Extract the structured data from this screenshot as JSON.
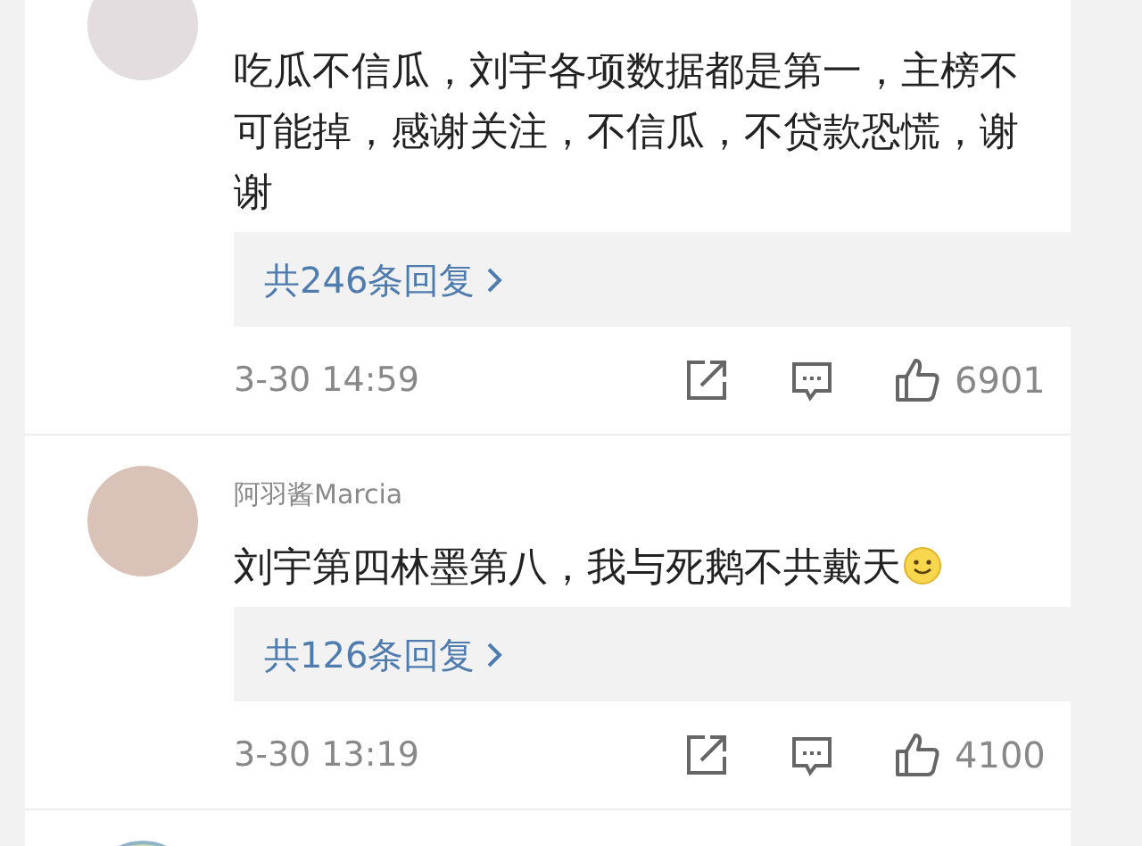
{
  "comments": [
    {
      "text": "吃瓜不信瓜，刘宇各项数据都是第一，主榜不可能掉，感谢关注，不信瓜，不贷款恐慌，谢谢",
      "smiley": false,
      "replies": "共246条回复",
      "time": "3-30 14:59",
      "likes": "6901"
    },
    {
      "username": "阿羽酱Marcia",
      "text": "刘宇第四林墨第八，我与死鹅不共戴天",
      "smiley": true,
      "replies": "共126条回复",
      "time": "3-30 13:19",
      "likes": "4100"
    }
  ]
}
